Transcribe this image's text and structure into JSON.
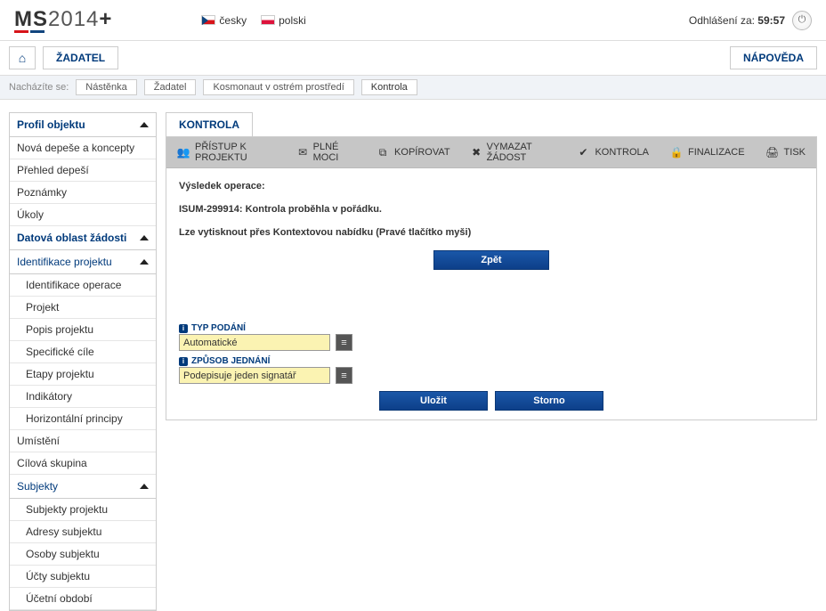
{
  "header": {
    "logo_prefix": "MS",
    "logo_year": "2014",
    "logo_suffix": "+",
    "lang_cs": "česky",
    "lang_pl": "polski",
    "logout_prefix": "Odhlášení za:",
    "logout_time": "59:57"
  },
  "toolbar": {
    "zadatel": "ŽADATEL",
    "napoveda": "NÁPOVĚDA"
  },
  "breadcrumb": {
    "label": "Nacházíte se:",
    "items": [
      "Nástěnka",
      "Žadatel",
      "Kosmonaut v ostrém prostředí",
      "Kontrola"
    ]
  },
  "sidebar": {
    "profil_header": "Profil objektu",
    "profil_items": [
      "Nová depeše a koncepty",
      "Přehled depeší",
      "Poznámky",
      "Úkoly"
    ],
    "datova_header": "Datová oblast žádosti",
    "ident_header": "Identifikace projektu",
    "ident_items": [
      "Identifikace operace",
      "Projekt",
      "Popis projektu",
      "Specifické cíle",
      "Etapy projektu",
      "Indikátory",
      "Horizontální principy"
    ],
    "umisteni": "Umístění",
    "cilova": "Cílová skupina",
    "subjekty_header": "Subjekty",
    "subjekty_items": [
      "Subjekty projektu",
      "Adresy subjektu",
      "Osoby subjektu",
      "Účty subjektu",
      "Účetní období"
    ]
  },
  "tab": {
    "title": "KONTROLA"
  },
  "actions": {
    "pristup": "PŘÍSTUP K PROJEKTU",
    "plnemoci": "PLNÉ MOCI",
    "kopirovat": "KOPÍROVAT",
    "vymazat": "VYMAZAT ŽÁDOST",
    "kontrola": "KONTROLA",
    "finalizace": "FINALIZACE",
    "tisk": "TISK"
  },
  "result": {
    "title": "Výsledek operace:",
    "message": "ISUM-299914: Kontrola proběhla v pořádku.",
    "print_hint": "Lze vytisknout přes Kontextovou nabídku (Pravé tlačítko myši)",
    "back": "Zpět"
  },
  "fields": {
    "typ_label": "TYP PODÁNÍ",
    "typ_value": "Automatické",
    "zpusob_label": "ZPŮSOB JEDNÁNÍ",
    "zpusob_value": "Podepisuje jeden signatář"
  },
  "buttons": {
    "save": "Uložit",
    "storno": "Storno"
  }
}
